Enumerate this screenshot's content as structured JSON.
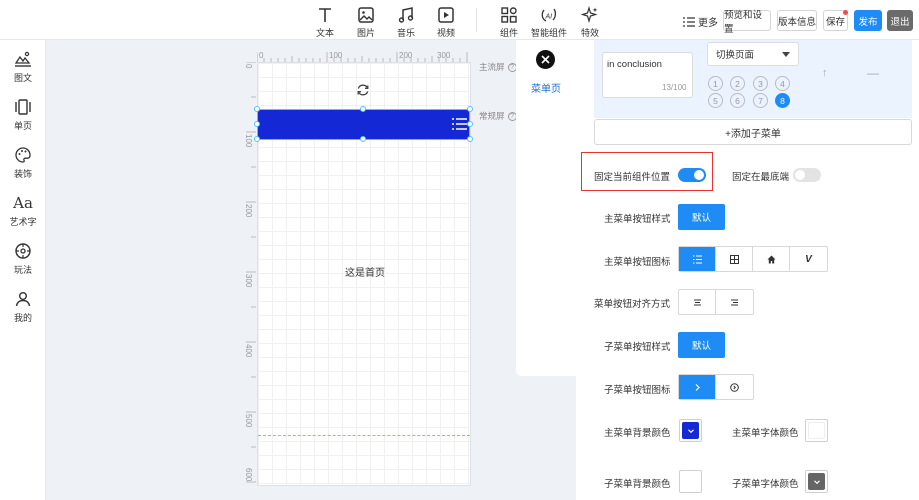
{
  "toolbar": {
    "tools": [
      {
        "label": "文本",
        "icon": "text-icon"
      },
      {
        "label": "图片",
        "icon": "image-icon"
      },
      {
        "label": "音乐",
        "icon": "music-icon"
      },
      {
        "label": "视频",
        "icon": "video-icon"
      },
      {
        "label": "组件",
        "icon": "components-icon"
      },
      {
        "label": "智能组件",
        "icon": "ai-icon"
      },
      {
        "label": "特效",
        "icon": "sparkle-icon"
      }
    ],
    "more_label": "更多",
    "preview_label": "预览和设置",
    "version_label": "版本信息",
    "save_label": "保存",
    "publish_label": "发布",
    "exit_label": "退出"
  },
  "sidebar": {
    "items": [
      {
        "label": "图文",
        "icon": "image-text-icon"
      },
      {
        "label": "单页",
        "icon": "single-page-icon"
      },
      {
        "label": "装饰",
        "icon": "palette-icon"
      },
      {
        "label": "艺术字",
        "icon": "art-text-icon"
      },
      {
        "label": "玩法",
        "icon": "play-icon"
      },
      {
        "label": "我的",
        "icon": "user-icon"
      }
    ],
    "art_glyph": "Aa"
  },
  "canvas": {
    "ruler_top": [
      "0",
      "100",
      "200",
      "300"
    ],
    "ruler_left": [
      "0",
      "100",
      "200",
      "300",
      "400",
      "500",
      "600"
    ],
    "main_screen_label": "主流屏",
    "normal_screen_label": "常规屏",
    "help_glyph": "?",
    "home_text": "这是首页"
  },
  "menu_panel": {
    "tab_label": "菜单页",
    "submenu_text": "in conclusion",
    "submenu_count": "13/100",
    "switch_page_label": "切换页面",
    "page_numbers": [
      "1",
      "2",
      "3",
      "4",
      "5",
      "6",
      "7",
      "8"
    ],
    "active_page": "8",
    "up_glyph": "↑",
    "minus_glyph": "—",
    "add_submenu_label": "+添加子菜单",
    "fix_position_label": "固定当前组件位置",
    "fix_position_on": true,
    "fix_bottom_label": "固定在最底端",
    "fix_bottom_on": false,
    "main_btn_style_label": "主菜单按钮样式",
    "main_btn_style_value": "默认",
    "main_btn_icon_label": "主菜单按钮图标",
    "main_btn_icon_glyph_v": "V",
    "align_label": "菜单按钮对齐方式",
    "sub_btn_style_label": "子菜单按钮样式",
    "sub_btn_style_value": "默认",
    "sub_btn_icon_label": "子菜单按钮图标",
    "main_bg_color_label": "主菜单背景颜色",
    "main_font_color_label": "主菜单字体颜色",
    "sub_bg_color_label": "子菜单背景颜色",
    "sub_font_color_label": "子菜单字体颜色",
    "colors": {
      "accent": "#1f8bf5",
      "main_bg": "#1528d6",
      "main_font": "#ffffff",
      "sub_bg": "#ffffff",
      "sub_font": "#666666",
      "highlight": "#e8322d"
    }
  }
}
